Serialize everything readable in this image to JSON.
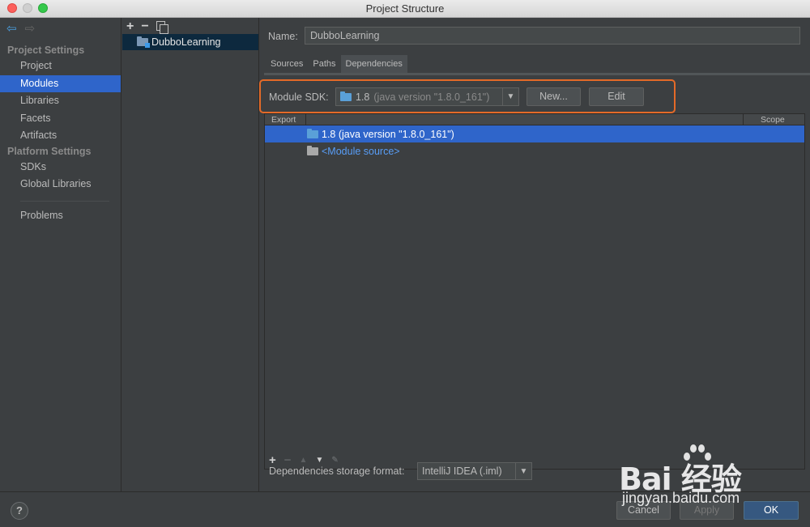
{
  "window": {
    "title": "Project Structure"
  },
  "left_nav": {
    "project_settings_header": "Project Settings",
    "items_project": [
      "Project",
      "Modules",
      "Libraries",
      "Facets",
      "Artifacts"
    ],
    "platform_settings_header": "Platform Settings",
    "items_platform": [
      "SDKs",
      "Global Libraries"
    ],
    "problems": "Problems",
    "selected": "Modules"
  },
  "modules": {
    "toolbar": {
      "add": "+",
      "remove": "−"
    },
    "list": [
      "DubboLearning"
    ]
  },
  "module_settings": {
    "name_label": "Name:",
    "name_value": "DubboLearning",
    "tabs": [
      "Sources",
      "Paths",
      "Dependencies"
    ],
    "active_tab": "Dependencies",
    "sdk_label": "Module SDK:",
    "sdk_value": "1.8",
    "sdk_detail": "(java version \"1.8.0_161\")",
    "new_button": "New...",
    "edit_button": "Edit",
    "table": {
      "col_export": "Export",
      "col_scope": "Scope",
      "rows": [
        {
          "label": "1.8 (java version \"1.8.0_161\")",
          "selected": true
        },
        {
          "label": "<Module source>",
          "selected": false
        }
      ]
    },
    "storage_label": "Dependencies storage format:",
    "storage_value": "IntelliJ IDEA (.iml)"
  },
  "dialog_buttons": {
    "help": "?",
    "cancel": "Cancel",
    "apply": "Apply",
    "ok": "OK"
  },
  "watermark": {
    "brand": "Bai  经验",
    "url": "jingyan.baidu.com"
  },
  "colors": {
    "selection": "#2f65ca",
    "highlight_box": "#e46a28",
    "link": "#589df6"
  }
}
